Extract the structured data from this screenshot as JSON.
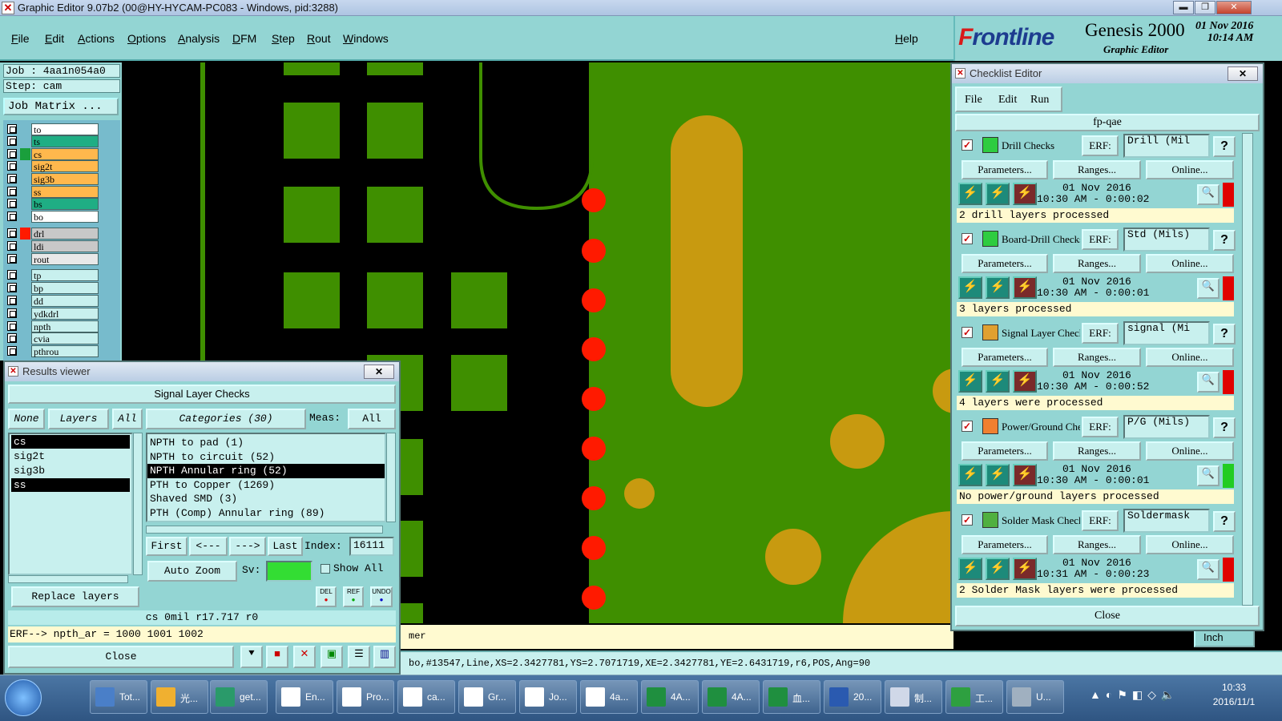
{
  "window": {
    "title": "Graphic Editor 9.07b2 (00@HY-HYCAM-PC083 - Windows, pid:3288)",
    "min_label": "▬",
    "max_label": "❐",
    "close_label": "✕"
  },
  "menu": {
    "items": [
      "File",
      "Edit",
      "Actions",
      "Options",
      "Analysis",
      "DFM",
      "Step",
      "Rout",
      "Windows"
    ],
    "help": "Help"
  },
  "brand": {
    "logo_f": "F",
    "logo_rest": "rontline",
    "product": "Genesis 2000",
    "subtitle": "Graphic Editor",
    "date": "01 Nov 2016",
    "time": "10:14 AM"
  },
  "left_panel": {
    "job": "Job : 4aa1n054a0",
    "step": "Step: cam",
    "job_matrix": "Job Matrix ...",
    "layers": [
      {
        "name": "to",
        "color": "#ffffff"
      },
      {
        "name": "ts",
        "color": "#1fae84"
      },
      {
        "name": "cs",
        "color": "#ffb84d"
      },
      {
        "name": "sig2t",
        "color": "#ffb84d"
      },
      {
        "name": "sig3b",
        "color": "#ffb84d"
      },
      {
        "name": "ss",
        "color": "#ffb84d"
      },
      {
        "name": "bs",
        "color": "#1fae84"
      },
      {
        "name": "bo",
        "color": "#ffffff"
      },
      {
        "name": "drl",
        "color": "#c8c8c8"
      },
      {
        "name": "ldi",
        "color": "#c8c8c8"
      },
      {
        "name": "rout",
        "color": "#e8e8e8"
      },
      {
        "name": "tp",
        "color": "#c8f0ee"
      },
      {
        "name": "bp",
        "color": "#c8f0ee"
      },
      {
        "name": "dd",
        "color": "#c8f0ee"
      },
      {
        "name": "ydkdrl",
        "color": "#c8f0ee"
      },
      {
        "name": "npth",
        "color": "#c8f0ee"
      },
      {
        "name": "cvia",
        "color": "#c8f0ee"
      },
      {
        "name": "pthrou",
        "color": "#c8f0ee"
      }
    ]
  },
  "results_viewer": {
    "title": "Results viewer",
    "close_x": "✕",
    "header": "Signal Layer Checks",
    "none_btn": "None",
    "layers_btn": "Layers",
    "all_btn": "All",
    "categories_btn": "Categories (30)",
    "meas_label": "Meas:",
    "meas_value": "All",
    "layers": [
      "cs",
      "sig2t",
      "sig3b",
      "ss"
    ],
    "categories": [
      "NPTH to pad (1)",
      "NPTH to circuit (52)",
      "NPTH Annular ring (52)",
      "PTH to Copper (1269)",
      "Shaved SMD (3)",
      "PTH (Comp) Annular ring (89)"
    ],
    "first": "First",
    "prev": "<---",
    "next": "--->",
    "last": "Last",
    "index_label": "Index:",
    "index_value": "16111",
    "auto_zoom": "Auto Zoom",
    "sv_label": "Sv:",
    "show_all": "Show All",
    "replace_layers": "Replace layers",
    "del": "DEL",
    "ref": "REF",
    "undo": "UNDO",
    "info_line": "cs 0mil   r17.717  r0",
    "erf_line": "ERF--> npth_ar = 1000 1001 1002",
    "close": "Close"
  },
  "checklist_editor": {
    "title": "Checklist Editor",
    "close_x": "✕",
    "menu": [
      "File",
      "Edit",
      "Run"
    ],
    "checklist_name": "fp-qae",
    "erf_label": "ERF:",
    "params_label": "Parameters...",
    "ranges_label": "Ranges...",
    "online_label": "Online...",
    "help_label": "?",
    "close": "Close",
    "checks": [
      {
        "name": "Drill Checks",
        "erf": "Drill (Mil",
        "date": "01 Nov 2016",
        "time": "10:30 AM - 0:00:02",
        "message": "2 drill layers processed",
        "status": "#e00000",
        "icon_color": "#2ecc40"
      },
      {
        "name": "Board-Drill Checks",
        "erf": "Std (Mils)",
        "date": "01 Nov 2016",
        "time": "10:30 AM - 0:00:01",
        "message": "3 layers processed",
        "status": "#e00000",
        "icon_color": "#2ecc40"
      },
      {
        "name": "Signal Layer Checks",
        "erf": "signal (Mi",
        "date": "01 Nov 2016",
        "time": "10:30 AM - 0:00:52",
        "message": "4 layers were processed",
        "status": "#e00000",
        "icon_color": "#e0a030"
      },
      {
        "name": "Power/Ground Checks",
        "erf": "P/G (Mils)",
        "date": "01 Nov 2016",
        "time": "10:30 AM - 0:00:01",
        "message": "No power/ground layers processed",
        "status": "#22cc22",
        "icon_color": "#f08030"
      },
      {
        "name": "Solder Mask Checks",
        "erf": "Soldermask",
        "date": "01 Nov 2016",
        "time": "10:31 AM - 0:00:23",
        "message": "2 Solder Mask layers were processed",
        "status": "#e00000",
        "icon_color": "#50b040"
      }
    ]
  },
  "canvas": {
    "cmd_text": "mer",
    "inch_label": "Inch",
    "status_text": "bo,#13547,Line,XS=2.3427781,YS=2.7071719,XE=2.3427781,YE=2.6431719,r6,POS,Ang=90",
    "copper_color": "#3f8f00",
    "mask_color": "#c89a10",
    "drill_color": "#ff1a00"
  },
  "taskbar": {
    "items": [
      {
        "label": "Tot...",
        "color": "#4a7fc8"
      },
      {
        "label": "光...",
        "color": "#f0b030"
      },
      {
        "label": "get...",
        "color": "#2a9a6a"
      },
      {
        "label": "En...",
        "color": "#ffffff"
      },
      {
        "label": "Pro...",
        "color": "#ffffff"
      },
      {
        "label": "ca...",
        "color": "#ffffff"
      },
      {
        "label": "Gr...",
        "color": "#ffffff"
      },
      {
        "label": "Jo...",
        "color": "#ffffff"
      },
      {
        "label": "4a...",
        "color": "#ffffff"
      },
      {
        "label": "4A...",
        "color": "#1f8f3f"
      },
      {
        "label": "4A...",
        "color": "#1f8f3f"
      },
      {
        "label": "血...",
        "color": "#1f8f3f"
      },
      {
        "label": "20...",
        "color": "#2a5ab0"
      },
      {
        "label": "制...",
        "color": "#d0d8e8"
      },
      {
        "label": "工...",
        "color": "#2ea040"
      },
      {
        "label": "U...",
        "color": "#a0b0c0"
      }
    ],
    "time": "10:33",
    "date": "2016/11/1"
  }
}
